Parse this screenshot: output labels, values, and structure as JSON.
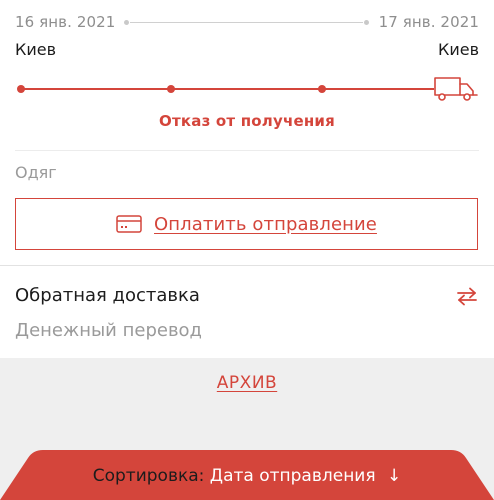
{
  "shipment": {
    "from_date": "16 янв. 2021",
    "to_date": "17 янв. 2021",
    "from_city": "Киев",
    "to_city": "Киев",
    "status": "Отказ от получения",
    "description": "Одяг",
    "pay_button": "Оплатить отправление",
    "icons": {
      "vehicle": "truck-icon",
      "payment": "credit-card-icon"
    }
  },
  "return_section": {
    "title": "Обратная доставка",
    "subtitle": "Денежный перевод",
    "icon": "swap-arrows-icon"
  },
  "archive_link": "АРХИВ",
  "sort": {
    "label": "Сортировка:",
    "value": "Дата отправления",
    "direction": "↓"
  },
  "colors": {
    "accent": "#d4453b",
    "text": "#1c1c1c",
    "muted": "#9a9a9a",
    "grey_bg": "#efefef"
  }
}
